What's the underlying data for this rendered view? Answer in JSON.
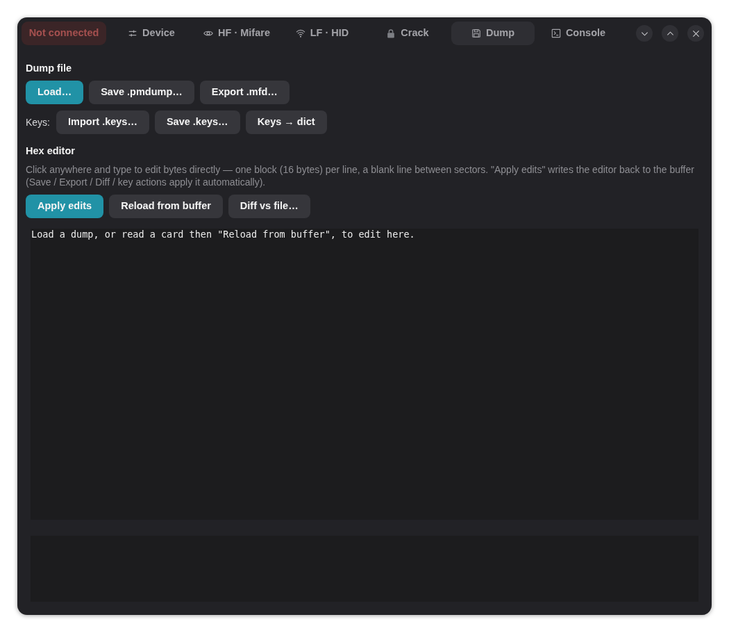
{
  "status": {
    "label": "Not connected",
    "connected": false
  },
  "tabs": [
    {
      "label": "Device",
      "selected": false
    },
    {
      "label": "HF · Mifare",
      "selected": false
    },
    {
      "label": "LF · HID",
      "selected": false
    },
    {
      "label": "Crack",
      "selected": false
    },
    {
      "label": "Dump",
      "selected": true
    },
    {
      "label": "Console",
      "selected": false
    }
  ],
  "dump_file": {
    "title": "Dump file",
    "buttons": [
      {
        "label": "Load…",
        "primary": true
      },
      {
        "label": "Save .pmdump…",
        "primary": false
      },
      {
        "label": "Export .mfd…",
        "primary": false
      }
    ],
    "keys_label": "Keys:",
    "key_buttons": [
      {
        "label": "Import .keys…",
        "primary": false
      },
      {
        "label": "Save .keys…",
        "primary": false
      },
      {
        "label": "Keys → dict",
        "primary": false
      }
    ]
  },
  "hex_editor": {
    "title": "Hex editor",
    "description": "Click anywhere and type to edit bytes directly — one block (16 bytes) per line, a blank line between sectors. \"Apply edits\" writes the editor back to the buffer (Save / Export / Diff / key actions apply it automatically).",
    "buttons": [
      {
        "label": "Apply edits",
        "primary": true
      },
      {
        "label": "Reload from buffer",
        "primary": false
      },
      {
        "label": "Diff vs file…",
        "primary": false
      }
    ],
    "text": "Load a dump, or read a card then \"Reload from buffer\", to edit here."
  }
}
